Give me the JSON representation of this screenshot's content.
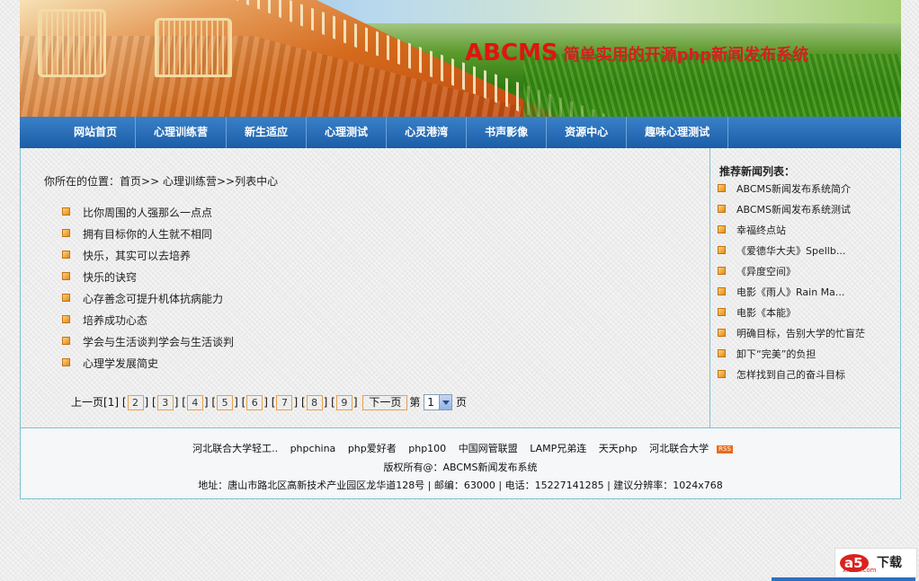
{
  "banner": {
    "title_en": "ABCMS",
    "title_cn": "简单实用的开源php新闻发布系统"
  },
  "nav": {
    "items": [
      "网站首页",
      "心理训练营",
      "新生适应",
      "心理测试",
      "心灵港湾",
      "书声影像",
      "资源中心",
      "趣味心理测试"
    ]
  },
  "breadcrumb": {
    "prefix": "你所在的位置：",
    "home": "首页",
    "sep1": ">> ",
    "section": "心理训练营",
    "sep2": ">>",
    "current": "列表中心"
  },
  "articles": [
    "比你周围的人强那么一点点",
    "拥有目标你的人生就不相同",
    "快乐，其实可以去培养",
    "快乐的诀窍",
    "心存善念可提升机体抗病能力",
    "培养成功心态",
    "学会与生活谈判学会与生活谈判",
    "心理学发展简史"
  ],
  "pager": {
    "prev": "上一页",
    "current": "[1]",
    "pages": [
      "2",
      "3",
      "4",
      "5",
      "6",
      "7",
      "8",
      "9"
    ],
    "next": "下一页",
    "di": "第",
    "selected": "1",
    "ye": "页"
  },
  "sidebar": {
    "title": "推荐新闻列表：",
    "items": [
      "ABCMS新闻发布系统简介",
      "ABCMS新闻发布系统测试",
      "幸福终点站",
      "《爱德华大夫》Spellb...",
      "《异度空间》",
      "电影《雨人》Rain Ma...",
      "电影《本能》",
      "明确目标，告别大学的忙盲茫",
      "卸下“完美”的负担",
      "怎样找到自己的奋斗目标"
    ]
  },
  "footer": {
    "links": [
      "河北联合大学轻工..",
      "phpchina",
      "php爱好者",
      "php100",
      "中国网管联盟",
      "LAMP兄弟连",
      "天天php",
      "河北联合大学"
    ],
    "rss": "RSS",
    "copyright": "版权所有@：ABCMS新闻发布系统",
    "address": "地址：唐山市路北区高新技术产业园区龙华道128号 | 邮编：63000 | 电话：15227141285 | 建议分辨率：1024x768"
  },
  "watermark": {
    "logo": "a5",
    "text": "下载",
    "sub": "xiazai.com"
  },
  "colors": {
    "nav": "#1a5ea7",
    "title_red": "#e01414",
    "border": "#7fc1cf",
    "bullet": "#e48a14"
  }
}
